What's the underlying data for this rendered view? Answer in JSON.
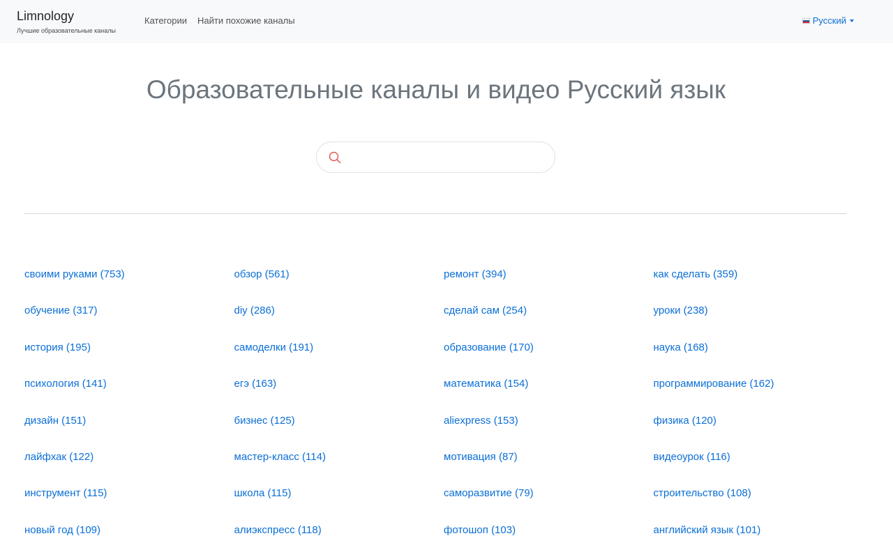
{
  "navbar": {
    "brand_title": "Limnology",
    "brand_subtitle": "Лучшие образовательные каналы",
    "links": [
      "Категории",
      "Найти похожие каналы"
    ],
    "language": "Русский"
  },
  "main": {
    "heading": "Образовательные каналы и видео Русский язык",
    "search": {
      "value": "",
      "placeholder": ""
    }
  },
  "tags": [
    "своими руками (753)",
    "обзор (561)",
    "ремонт (394)",
    "как сделать (359)",
    "обучение (317)",
    "diy (286)",
    "сделай сам (254)",
    "уроки (238)",
    "история (195)",
    "самоделки (191)",
    "образование (170)",
    "наука (168)",
    "психология (141)",
    "егэ (163)",
    "математика (154)",
    "программирование (162)",
    "дизайн (151)",
    "бизнес (125)",
    "aliexpress (153)",
    "физика (120)",
    "лайфхак (122)",
    "мастер-класс (114)",
    "мотивация (87)",
    "видеоурок (116)",
    "инструмент (115)",
    "школа (115)",
    "саморазвитие (79)",
    "строительство (108)",
    "новый год (109)",
    "алиэкспресс (118)",
    "фотошоп (103)",
    "английский язык (101)"
  ],
  "colors": {
    "link": "#0b6fd6",
    "heading": "#6c757d",
    "navbar_bg": "#f8f9fa",
    "search_icon": "#e05b55"
  },
  "icons": {
    "search": "search-icon",
    "flag": "russia-flag-icon",
    "caret": "caret-down-icon"
  }
}
